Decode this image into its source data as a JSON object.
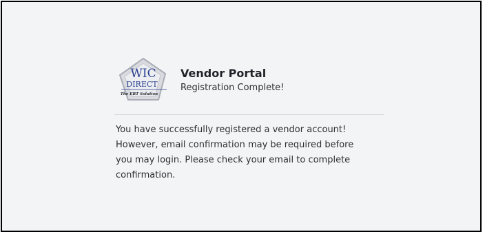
{
  "logo": {
    "line1": "WIC",
    "line2": "DIRECT",
    "tagline": "The EBT Solution"
  },
  "header": {
    "title": "Vendor Portal",
    "subtitle": "Registration Complete!"
  },
  "message": {
    "line1": "You have successfully registered a vendor account!",
    "line2": "However, email confirmation may be required before",
    "line3": "you may login. Please check your email to complete",
    "line4": "confirmation."
  },
  "colors": {
    "background": "#f3f4f6",
    "logo_blue": "#2a3f8f",
    "divider": "#d7dadd"
  }
}
